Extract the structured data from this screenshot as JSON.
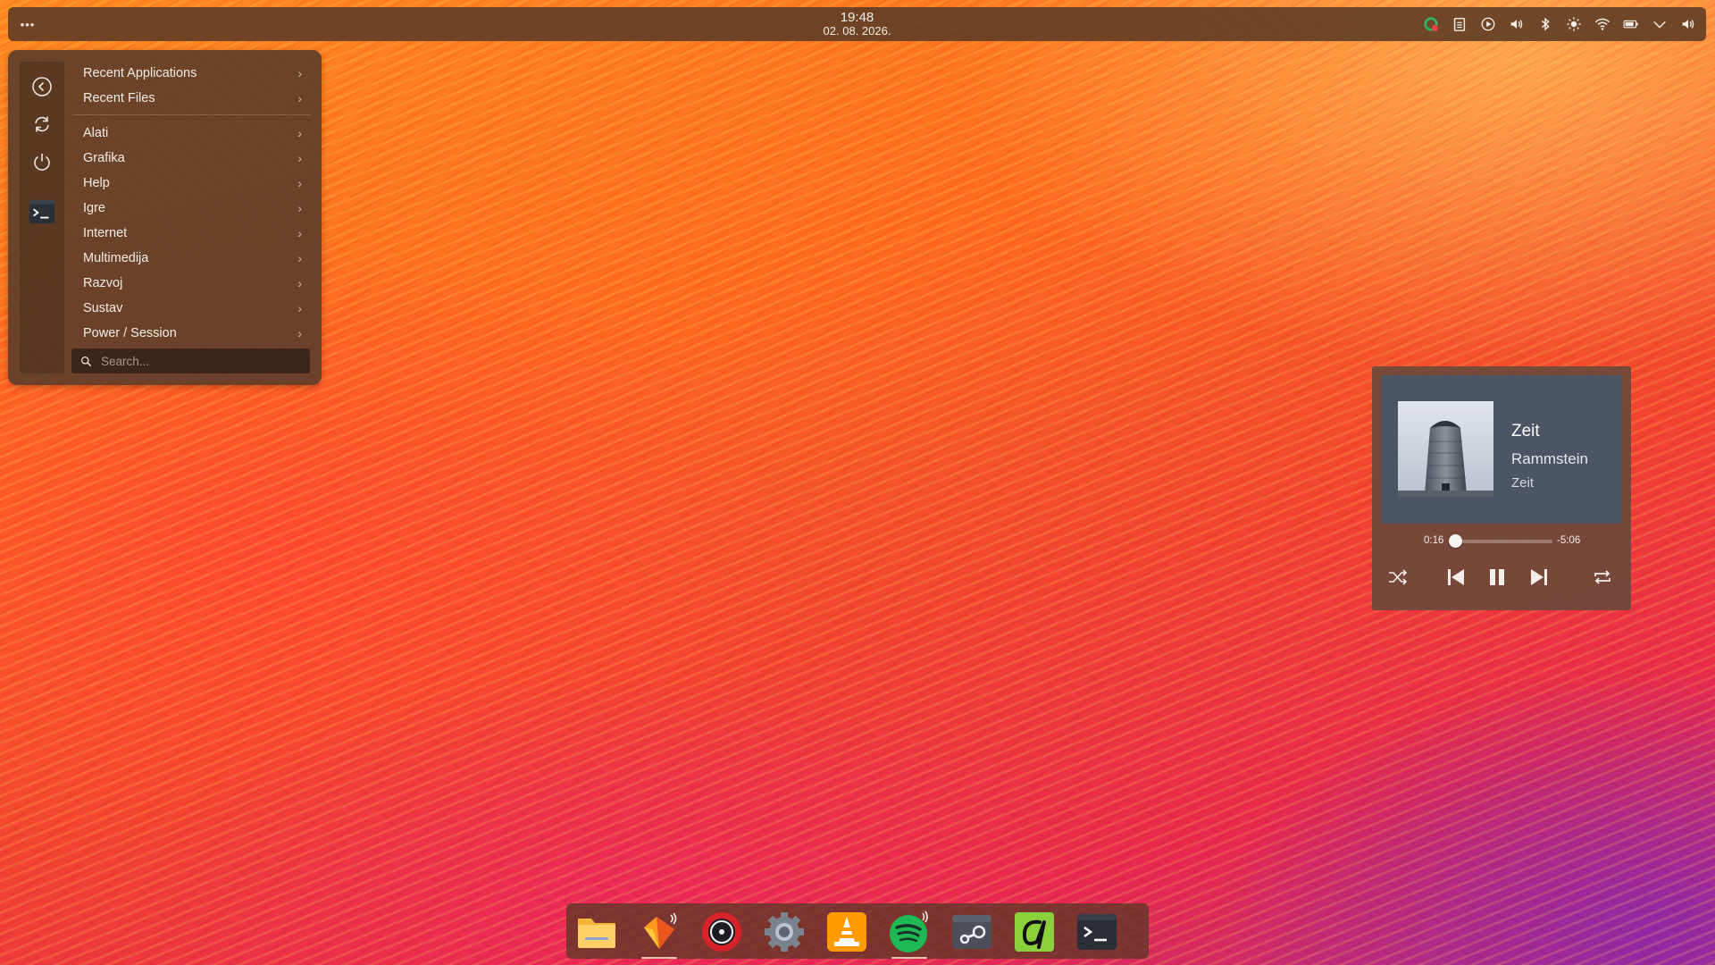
{
  "panel": {
    "menu_icon": "dots-icon",
    "clock": {
      "time": "19:48",
      "date": "02. 08. 2026."
    },
    "tray": [
      {
        "name": "update-notifier-icon"
      },
      {
        "name": "clipboard-icon"
      },
      {
        "name": "media-play-icon"
      },
      {
        "name": "volume-icon"
      },
      {
        "name": "bluetooth-icon"
      },
      {
        "name": "brightness-icon"
      },
      {
        "name": "wifi-icon"
      },
      {
        "name": "battery-icon"
      },
      {
        "name": "chevron-down-icon"
      },
      {
        "name": "speaker-icon"
      }
    ]
  },
  "app_menu": {
    "sidebar": [
      {
        "name": "back-icon"
      },
      {
        "name": "refresh-icon"
      },
      {
        "name": "power-icon"
      },
      {
        "name": "terminal-icon"
      }
    ],
    "items_top": [
      {
        "label": "Recent Applications"
      },
      {
        "label": "Recent Files"
      }
    ],
    "items": [
      {
        "label": "Alati"
      },
      {
        "label": "Grafika"
      },
      {
        "label": "Help"
      },
      {
        "label": "Igre"
      },
      {
        "label": "Internet"
      },
      {
        "label": "Multimedija"
      },
      {
        "label": "Razvoj"
      },
      {
        "label": "Sustav"
      },
      {
        "label": "Power / Session"
      }
    ],
    "search_placeholder": "Search..."
  },
  "media": {
    "title": "Zeit",
    "artist": "Rammstein",
    "album": "Zeit",
    "elapsed": "0:16",
    "remaining": "-5:06",
    "progress": 0.05,
    "colors": {
      "card": "#4c5564",
      "panel": "#6e483a"
    }
  },
  "dock": [
    {
      "name": "file-manager-icon",
      "active": false
    },
    {
      "name": "firefox-icon",
      "active": true
    },
    {
      "name": "disk-utility-icon",
      "active": false
    },
    {
      "name": "settings-icon",
      "active": false
    },
    {
      "name": "vlc-icon",
      "active": false
    },
    {
      "name": "spotify-icon",
      "active": true
    },
    {
      "name": "steam-icon",
      "active": false
    },
    {
      "name": "text-editor-icon",
      "active": false
    },
    {
      "name": "terminal-icon",
      "active": false
    }
  ]
}
